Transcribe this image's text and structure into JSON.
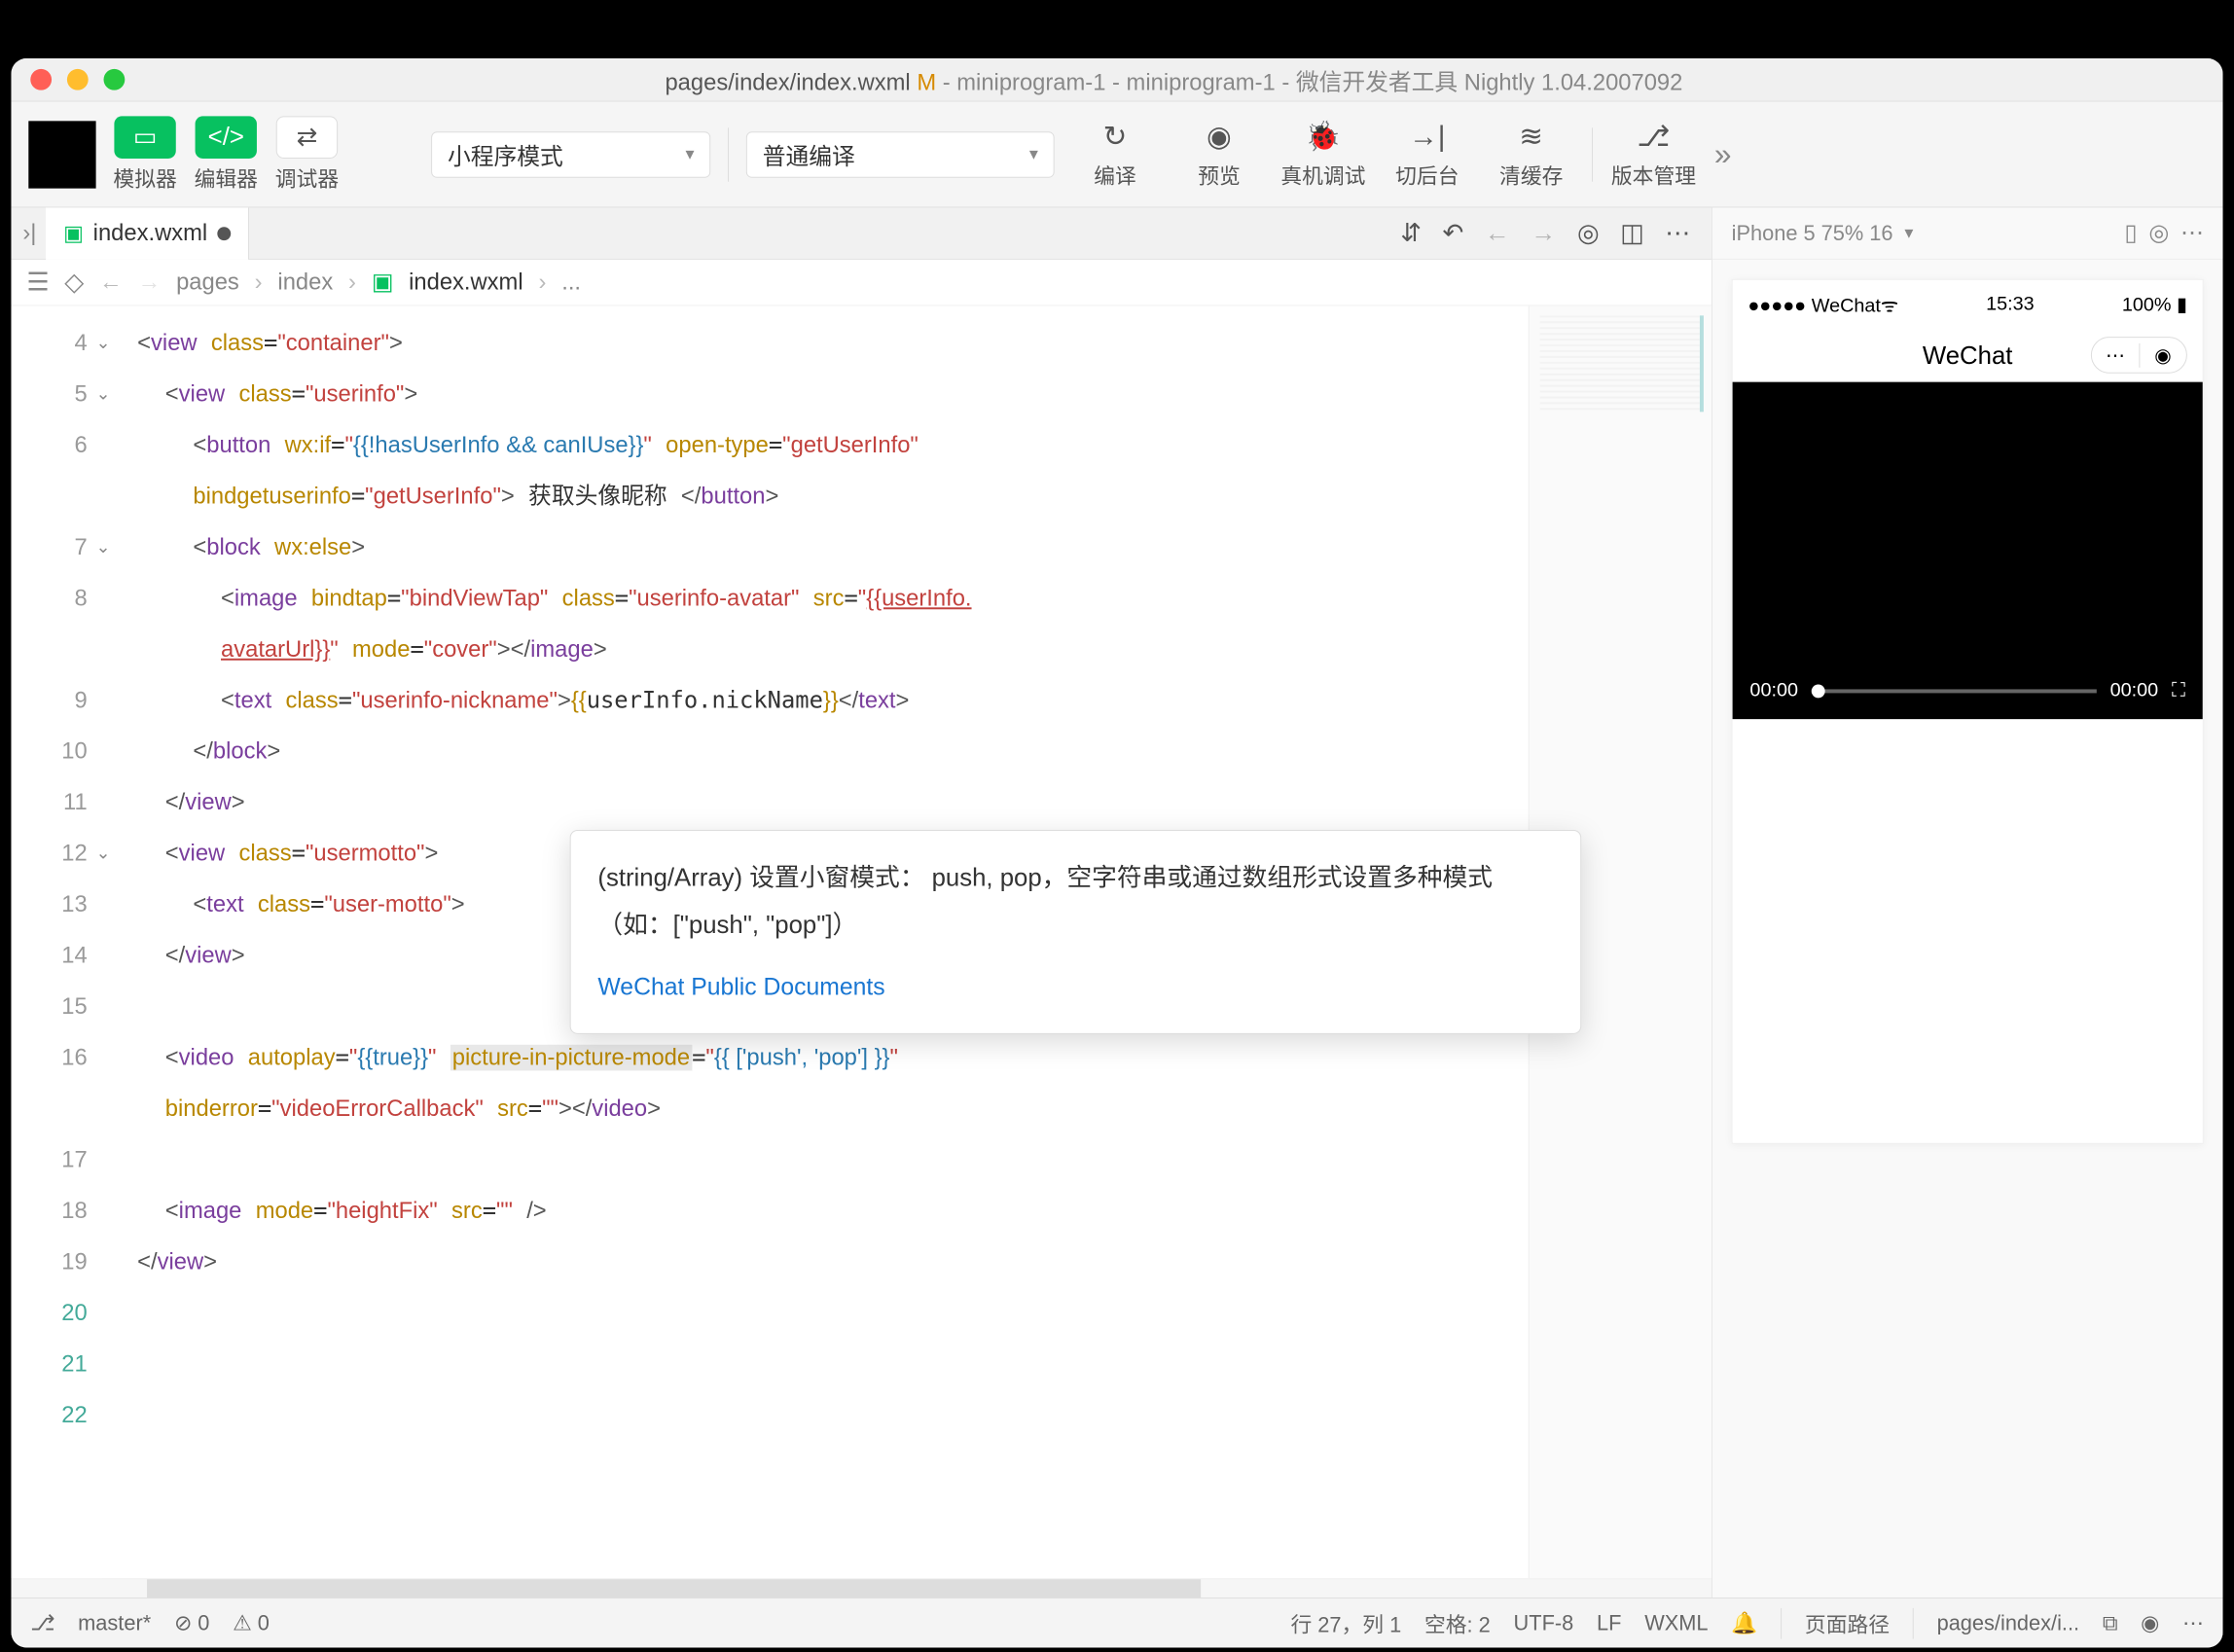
{
  "titlebar": {
    "filename": "pages/index/index.wxml",
    "modified_marker": "M",
    "project1": "miniprogram-1",
    "project2": "miniprogram-1",
    "app": "微信开发者工具 Nightly 1.04.2007092"
  },
  "toolbar": {
    "simulator": "模拟器",
    "editor": "编辑器",
    "debugger": "调试器",
    "mode_select": "小程序模式",
    "compile_select": "普通编译",
    "compile": "编译",
    "preview": "预览",
    "device_debug": "真机调试",
    "background": "切后台",
    "clear_cache": "清缓存",
    "version": "版本管理"
  },
  "tab": {
    "filename": "index.wxml"
  },
  "breadcrumb": {
    "p1": "pages",
    "p2": "index",
    "p3": "index.wxml",
    "p4": "..."
  },
  "code": {
    "line_start": 4,
    "line_end": 22,
    "l4": "<view class=\"container\">",
    "l5": "  <view class=\"userinfo\">",
    "l6a": "    <button wx:if=\"{{!hasUserInfo && canIUse}}\" open-type=\"getUserInfo\"",
    "l6b": "    bindgetuserinfo=\"getUserInfo\"> 获取头像昵称 </button>",
    "l7": "    <block wx:else>",
    "l8a": "      <image bindtap=\"bindViewTap\" class=\"userinfo-avatar\" src=\"{{userInfo.",
    "l8b": "      avatarUrl}}\" mode=\"cover\"></image>",
    "l9": "      <text class=\"userinfo-nickname\">{{userInfo.nickName}}</text>",
    "l10": "    </block>",
    "l11": "  </view>",
    "l12": "  <view class=\"usermotto\">",
    "l13": "    <text class=\"user-motto\">",
    "l14": "  </view>",
    "l15": "",
    "l16a": "  <video autoplay=\"{{true}}\" picture-in-picture-mode=\"{{ ['push', 'pop'] }}\"",
    "l16b": "  binderror=\"videoErrorCallback\" src=\"\"></video>",
    "l17": "",
    "l18": "  <image mode=\"heightFix\" src=\"\" />",
    "l19": "</view>"
  },
  "tooltip": {
    "body": "(string/Array) 设置小窗模式： push, pop，空字符串或通过数组形式设置多种模式（如：[\"push\", \"pop\"]）",
    "link": "WeChat Public Documents"
  },
  "simulator": {
    "device": "iPhone 5 75% 16",
    "status_left": "●●●●● WeChat",
    "status_time": "15:33",
    "status_right": "100%",
    "nav_title": "WeChat",
    "video_time_left": "00:00",
    "video_time_right": "00:00"
  },
  "statusbar": {
    "branch": "master*",
    "errors": "0",
    "warnings": "0",
    "cursor": "行 27，列 1",
    "spaces": "空格: 2",
    "encoding": "UTF-8",
    "eol": "LF",
    "lang": "WXML",
    "path_label": "页面路径",
    "path_value": "pages/index/i..."
  }
}
